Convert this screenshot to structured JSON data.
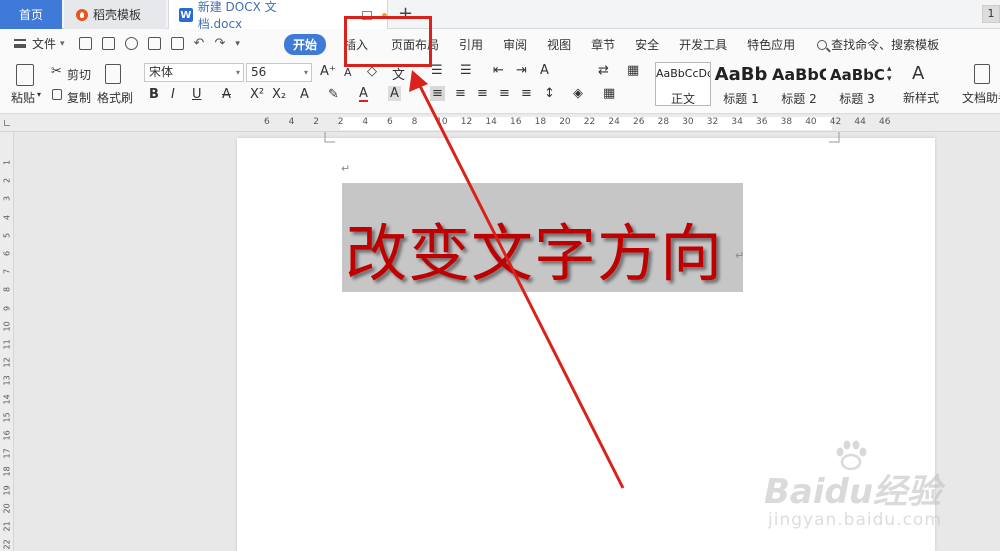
{
  "tabs": {
    "home": "首页",
    "daoke": "稻壳模板",
    "doc": "新建 DOCX 文档.docx",
    "add": "+",
    "badge": "1"
  },
  "menu": {
    "file": "文件",
    "items": [
      "开始",
      "插入",
      "页面布局",
      "引用",
      "审阅",
      "视图",
      "章节",
      "安全",
      "开发工具",
      "特色应用"
    ],
    "search": "查找命令、搜索模板"
  },
  "ribbon": {
    "paste": "粘贴",
    "cut": "剪切",
    "copy": "复制",
    "format_painter": "格式刷",
    "font_name": "宋体",
    "font_size": "56",
    "styles": [
      {
        "sample": "AaBbCcDd",
        "name": "正文"
      },
      {
        "sample": "AaBb",
        "name": "标题 1"
      },
      {
        "sample": "AaBbC",
        "name": "标题 2"
      },
      {
        "sample": "AaBbC",
        "name": "标题 3"
      }
    ],
    "new_style": "新样式",
    "doc_helper": "文档助手"
  },
  "ruler": {
    "h_ticks": [
      "6",
      "4",
      "2",
      "2",
      "4",
      "6",
      "8",
      "10",
      "12",
      "14",
      "16",
      "18",
      "20",
      "22",
      "24",
      "26",
      "28",
      "30",
      "32",
      "34",
      "36",
      "38",
      "40",
      "42",
      "44",
      "46"
    ],
    "v_ticks": [
      "1",
      "2",
      "3",
      "4",
      "5",
      "6",
      "7",
      "8",
      "9",
      "10",
      "11",
      "12",
      "13",
      "14",
      "15",
      "16",
      "17",
      "18",
      "19",
      "20",
      "21",
      "22"
    ]
  },
  "document": {
    "heading_text": "改变文字方向",
    "text_color": "#c00000"
  },
  "annotation": {
    "color": "#d9221c",
    "target": "页面布局"
  },
  "watermark": {
    "brand": "Baidu经验",
    "url": "jingyan.baidu.com"
  }
}
